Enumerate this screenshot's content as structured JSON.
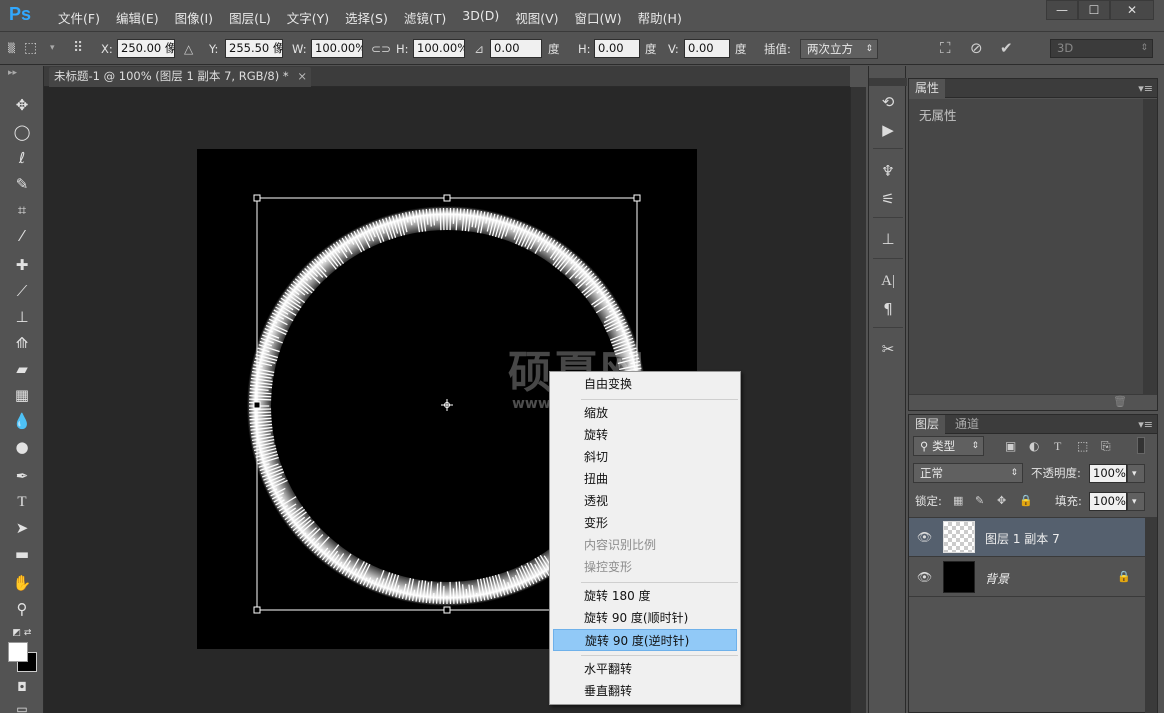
{
  "app": {
    "logo": "Ps",
    "menu": [
      "文件(F)",
      "编辑(E)",
      "图像(I)",
      "图层(L)",
      "文字(Y)",
      "选择(S)",
      "滤镜(T)",
      "3D(D)",
      "视图(V)",
      "窗口(W)",
      "帮助(H)"
    ],
    "window_controls": [
      "—",
      "☐",
      "✕"
    ]
  },
  "options": {
    "x_label": "X:",
    "x_value": "250.00 像",
    "y_label": "Y:",
    "y_value": "255.50 像",
    "w_label": "W:",
    "w_value": "100.00%",
    "h_label": "H:",
    "h_value": "100.00%",
    "angle_value": "0.00",
    "angle_unit": "度",
    "hskew_label": "H:",
    "hskew_value": "0.00",
    "hskew_unit": "度",
    "vskew_label": "V:",
    "vskew_value": "0.00",
    "vskew_unit": "度",
    "interp_label": "插值:",
    "interp_value": "两次立方",
    "workspace": "3D"
  },
  "document": {
    "tab_title": "未标题-1 @ 100% (图层 1 副本 7, RGB/8) *",
    "tab_close": "×"
  },
  "context_menu": {
    "items": [
      {
        "label": "自由变换",
        "state": "normal"
      },
      {
        "label": "缩放",
        "state": "normal"
      },
      {
        "label": "旋转",
        "state": "normal"
      },
      {
        "label": "斜切",
        "state": "normal"
      },
      {
        "label": "扭曲",
        "state": "normal"
      },
      {
        "label": "透视",
        "state": "normal"
      },
      {
        "label": "变形",
        "state": "normal"
      },
      {
        "label": "内容识别比例",
        "state": "disabled"
      },
      {
        "label": "操控变形",
        "state": "disabled"
      },
      {
        "label": "旋转 180 度",
        "state": "normal"
      },
      {
        "label": "旋转 90 度(顺时针)",
        "state": "normal"
      },
      {
        "label": "旋转 90 度(逆时针)",
        "state": "highlighted"
      },
      {
        "label": "水平翻转",
        "state": "normal"
      },
      {
        "label": "垂直翻转",
        "state": "normal"
      }
    ]
  },
  "watermark": {
    "main": "硕夏网",
    "sub": "www"
  },
  "properties_panel": {
    "tab": "属性",
    "empty_text": "无属性"
  },
  "layers_panel": {
    "tabs": [
      "图层",
      "通道"
    ],
    "filter_label": "类型",
    "blend_mode": "正常",
    "opacity_label": "不透明度:",
    "opacity_value": "100%",
    "lock_label": "锁定:",
    "fill_label": "填充:",
    "fill_value": "100%",
    "layers": [
      {
        "name": "图层 1 副本 7",
        "selected": true,
        "locked": false
      },
      {
        "name": "背景",
        "selected": false,
        "locked": true
      }
    ]
  },
  "colors": {
    "ui_bg": "#535353",
    "canvas_bg": "#282828",
    "highlight": "#91c9f7",
    "selected_layer": "#55606e",
    "brand": "#31a8ff"
  }
}
